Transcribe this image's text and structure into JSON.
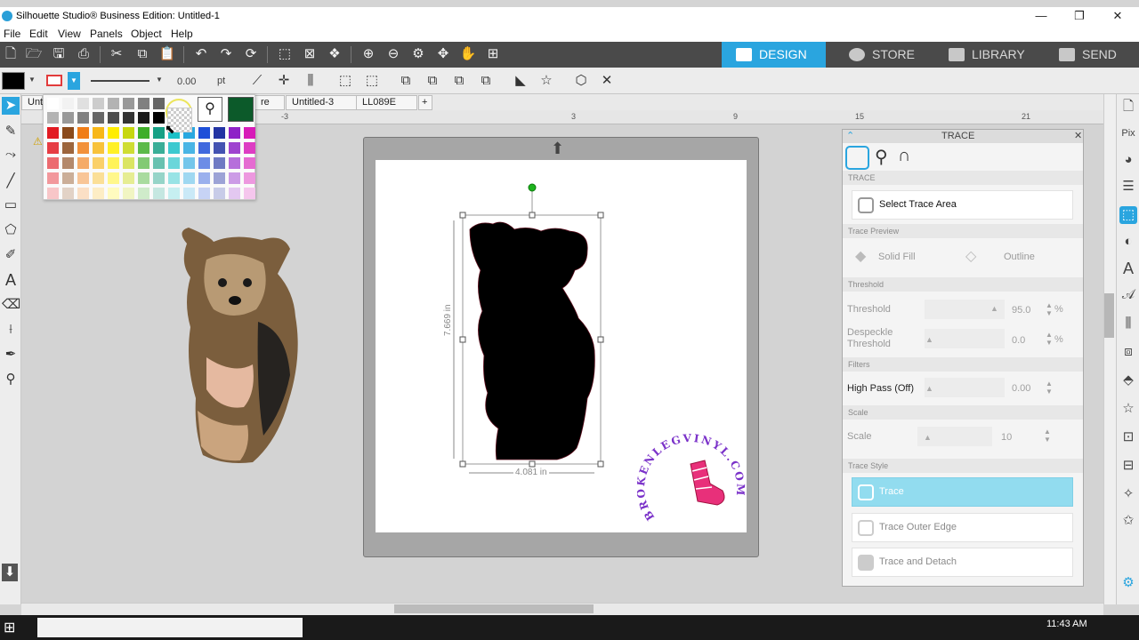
{
  "window": {
    "title": "Silhouette Studio® Business Edition: Untitled-1",
    "controls": [
      "—",
      "❐",
      "✕"
    ]
  },
  "menu": [
    "File",
    "Edit",
    "View",
    "Panels",
    "Object",
    "Help"
  ],
  "nav_tabs": [
    {
      "label": "DESIGN",
      "active": true
    },
    {
      "label": "STORE",
      "active": false
    },
    {
      "label": "LIBRARY",
      "active": false
    },
    {
      "label": "SEND",
      "active": false
    }
  ],
  "toolbar2": {
    "line_width": "0.00",
    "line_unit": "pt"
  },
  "doc_tabs": [
    "Unt",
    "re",
    "Untitled-3",
    "LL089E",
    "+"
  ],
  "ruler_numbers": [
    "-3",
    "3",
    "9",
    "15",
    "21"
  ],
  "selection": {
    "height_label": "7.669 in",
    "width_label": "4.081 in"
  },
  "watermark": {
    "text": "BROKENLEGVINYL.COM"
  },
  "palette": {
    "grays": [
      "#ffffff",
      "#f2f2f2",
      "#e0e0e0",
      "#cccccc",
      "#b3b3b3",
      "#999999",
      "#808080",
      "#666666",
      "#4d4d4d",
      "#333333",
      "#1a1a1a",
      "#000000"
    ],
    "row_colors": [
      "#e21b23",
      "#8b4a1b",
      "#f07d17",
      "#f7b718",
      "#ffed00",
      "#c7d70f",
      "#3fae29",
      "#16a085",
      "#19c0c6",
      "#29a8e0",
      "#1e4fd8",
      "#2233a3",
      "#8e22c7",
      "#d71bb8",
      "#e8297a"
    ],
    "selected_fill": "#000000",
    "eyedropper_color": "#0c5a2a"
  },
  "trace_panel": {
    "title": "TRACE",
    "select_area": "Select Trace Area",
    "preview_section": "Trace Preview",
    "solid_fill": "Solid Fill",
    "outline": "Outline",
    "threshold_section": "Threshold",
    "threshold_label": "Threshold",
    "threshold_value": "95.0",
    "despeckle_label": "Despeckle\nThreshold",
    "despeckle_value": "0.0",
    "percent": "%",
    "filters_section": "Filters",
    "high_pass_label": "High Pass (Off)",
    "high_pass_value": "0.00",
    "scale_section": "Scale",
    "scale_label": "Scale",
    "scale_value": "10",
    "style_section": "Trace Style",
    "trace_btn": "Trace",
    "trace_outer": "Trace Outer Edge",
    "trace_detach": "Trace and Detach",
    "accent": "#92dcef"
  },
  "taskbar": {
    "time": "11:43 AM"
  }
}
